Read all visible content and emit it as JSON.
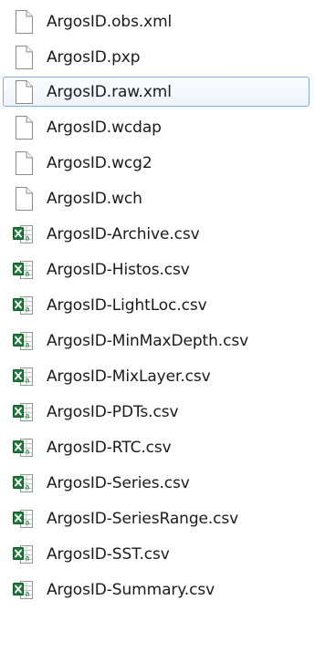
{
  "files": [
    {
      "name": "ArgosID.obs.xml",
      "icon": "blank-file-icon"
    },
    {
      "name": "ArgosID.pxp",
      "icon": "blank-file-icon"
    },
    {
      "name": "ArgosID.raw.xml",
      "icon": "blank-file-icon",
      "selected": true
    },
    {
      "name": "ArgosID.wcdap",
      "icon": "blank-file-icon"
    },
    {
      "name": "ArgosID.wcg2",
      "icon": "blank-file-icon"
    },
    {
      "name": "ArgosID.wch",
      "icon": "blank-file-icon"
    },
    {
      "name": "ArgosID-Archive.csv",
      "icon": "excel-csv-icon"
    },
    {
      "name": "ArgosID-Histos.csv",
      "icon": "excel-csv-icon"
    },
    {
      "name": "ArgosID-LightLoc.csv",
      "icon": "excel-csv-icon"
    },
    {
      "name": "ArgosID-MinMaxDepth.csv",
      "icon": "excel-csv-icon"
    },
    {
      "name": "ArgosID-MixLayer.csv",
      "icon": "excel-csv-icon"
    },
    {
      "name": "ArgosID-PDTs.csv",
      "icon": "excel-csv-icon"
    },
    {
      "name": "ArgosID-RTC.csv",
      "icon": "excel-csv-icon"
    },
    {
      "name": "ArgosID-Series.csv",
      "icon": "excel-csv-icon"
    },
    {
      "name": "ArgosID-SeriesRange.csv",
      "icon": "excel-csv-icon"
    },
    {
      "name": "ArgosID-SST.csv",
      "icon": "excel-csv-icon"
    },
    {
      "name": "ArgosID-Summary.csv",
      "icon": "excel-csv-icon"
    }
  ],
  "colors": {
    "selection_border": "#84acdd",
    "excel_green": "#1f7a3a"
  }
}
